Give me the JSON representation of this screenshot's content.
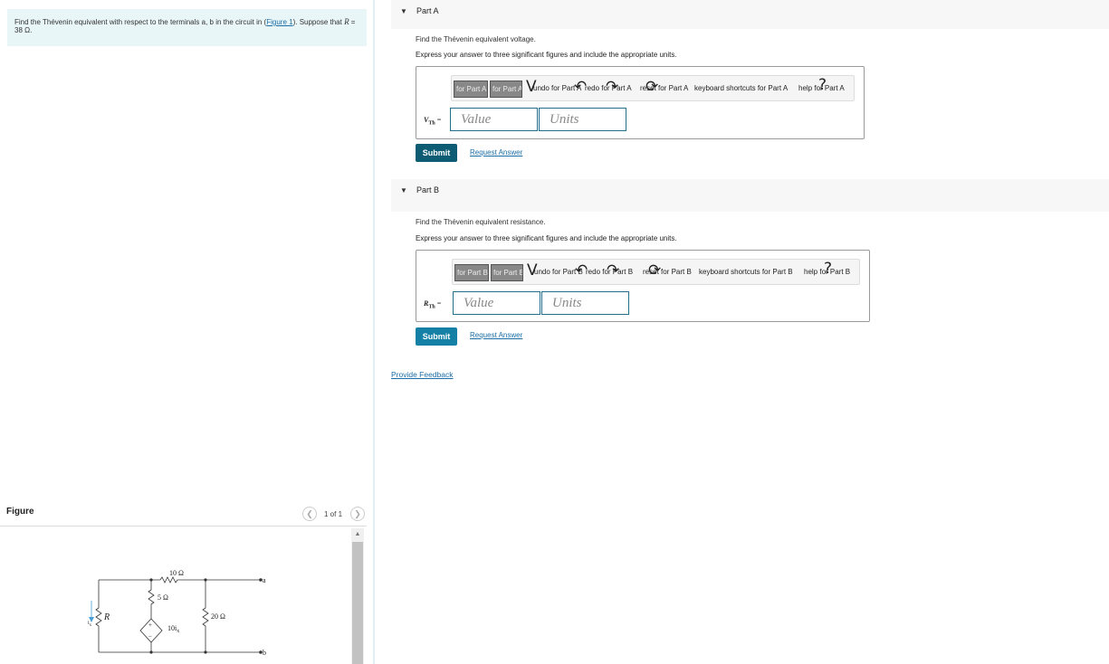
{
  "problem": {
    "text_before_link": "Find the Thévenin equivalent with respect to the terminals a, b in the circuit in (",
    "link": "Figure 1",
    "text_after_link": "). Suppose that ",
    "condition_var": "R",
    "condition_value": " = 38 Ω."
  },
  "figure": {
    "title": "Figure",
    "page_count": "1 of 1",
    "prev_icon": "chevron-left-icon",
    "next_icon": "chevron-right-icon",
    "circuit_labels": {
      "r10": "10 Ω",
      "r5": "5 Ω",
      "r20": "20 Ω",
      "R": "R",
      "source": "10i",
      "source_sub": "x",
      "current": "i",
      "current_sub": "x",
      "terminal_a": "a",
      "terminal_b": "b",
      "plus": "+",
      "minus": "−"
    }
  },
  "partA": {
    "title": "Part A",
    "question": "Find the Thévenin equivalent voltage.",
    "instruction": "Express your answer to three significant figures and include the appropriate units.",
    "toolbar": {
      "btn1": "for Part A",
      "btn2": "for Part A",
      "undo": "undo for Part A",
      "redo": "redo for Part A",
      "reset": "reset for Part A",
      "shortcuts": "keyboard shortcuts for Part A",
      "help": "help for Part A"
    },
    "label_var": "V",
    "label_sub": "Th",
    "value_placeholder": "Value",
    "units_placeholder": "Units",
    "submit": "Submit",
    "request": "Request Answer"
  },
  "partB": {
    "title": "Part B",
    "question": "Find the Thévenin equivalent resistance.",
    "instruction": "Express your answer to three significant figures and include the appropriate units.",
    "toolbar": {
      "btn1": "for Part B",
      "btn2": "for Part B",
      "undo": "undo for Part B",
      "redo": "redo for Part B",
      "reset": "reset for Part B",
      "shortcuts": "keyboard shortcuts for Part B",
      "help": "help for Part B"
    },
    "label_var": "R",
    "label_sub": "Th",
    "value_placeholder": "Value",
    "units_placeholder": "Units",
    "submit": "Submit",
    "request": "Request Answer"
  },
  "feedback": "Provide Feedback",
  "colors": {
    "problem_bg": "#e9f6f8",
    "submit_a": "#0e5c73",
    "submit_b": "#1480a6",
    "link": "#1b6ea8",
    "input_border": "#236f8b"
  }
}
